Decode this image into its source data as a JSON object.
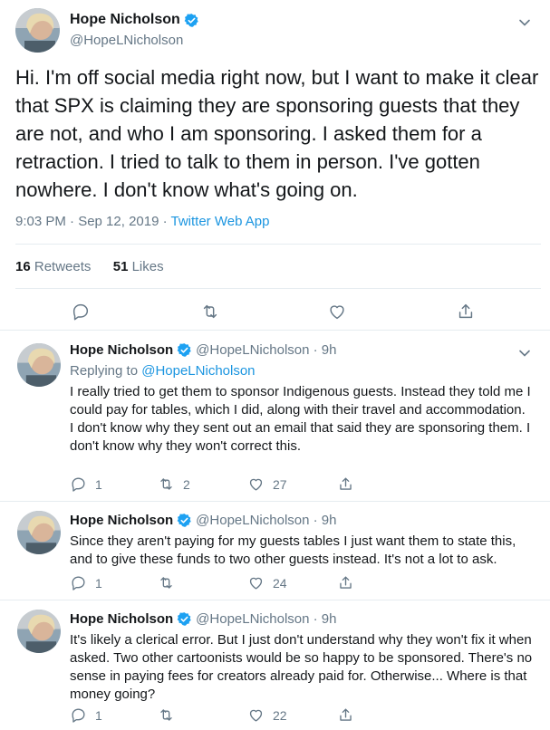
{
  "main_tweet": {
    "display_name": "Hope Nicholson",
    "handle": "@HopeLNicholson",
    "text": "Hi. I'm off social media right now, but I want to make it clear that SPX is claiming they are sponsoring guests that they are not, and who I am sponsoring. I asked them for a retraction. I tried to talk to them in person. I've gotten nowhere. I don't know what's going on.",
    "timestamp": "9:03 PM · Sep 12, 2019 · ",
    "source_app": "Twitter Web App",
    "retweet_count": "16",
    "retweet_label": "Retweets",
    "like_count": "51",
    "like_label": "Likes"
  },
  "replies": [
    {
      "display_name": "Hope Nicholson",
      "handle": "@HopeLNicholson · 9h",
      "replying_prefix": "Replying to ",
      "replying_to": "@HopeLNicholson",
      "text": "I really tried to get them to sponsor Indigenous guests. Instead they told me I could pay for tables, which I did, along with their travel and accommodation.\nI don't know why they sent out an email that said they are sponsoring them. I don't know why they won't correct this.",
      "reply_count": "1",
      "retweet_count": "2",
      "like_count": "27"
    },
    {
      "display_name": "Hope Nicholson",
      "handle": "@HopeLNicholson · 9h",
      "text": "Since they aren't paying for my guests tables I just want them to state this, and to give these funds to two other guests instead. It's not a lot to ask.",
      "reply_count": "1",
      "retweet_count": "",
      "like_count": "24"
    },
    {
      "display_name": "Hope Nicholson",
      "handle": "@HopeLNicholson · 9h",
      "text": "It's likely a clerical error. But I just don't understand why they won't fix it when asked. Two other cartoonists would be so happy to be sponsored. There's no sense in paying fees for creators already paid for. Otherwise... Where is that money going?",
      "reply_count": "1",
      "retweet_count": "",
      "like_count": "22"
    }
  ],
  "icons": {
    "verified": "verified-badge-icon",
    "caret": "chevron-down-icon",
    "reply": "reply-icon",
    "retweet": "retweet-icon",
    "like": "heart-icon",
    "share": "share-icon"
  },
  "colors": {
    "accent": "#1b95e0",
    "verified": "#1da1f2",
    "secondary_text": "#657786",
    "divider": "#e6ecf0"
  }
}
